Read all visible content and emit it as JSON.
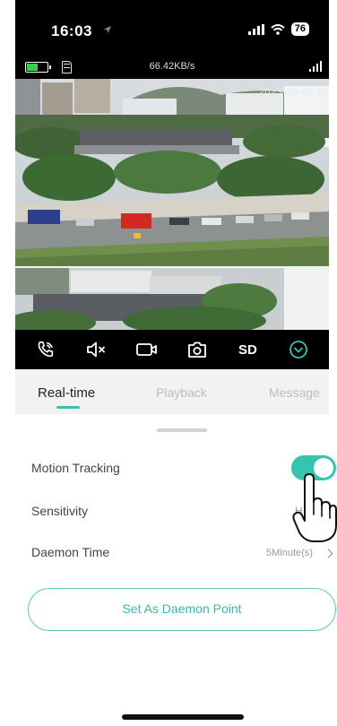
{
  "status_bar": {
    "time": "16:03",
    "battery": "76"
  },
  "camera_info": {
    "speed": "66.42KB/s",
    "battery_level": 0.5
  },
  "feed": {
    "timestamp": "2023-09-08 16:0"
  },
  "toolbar": {
    "items": [
      {
        "icon": "phone-call-icon"
      },
      {
        "icon": "speaker-mute-icon"
      },
      {
        "icon": "record-icon"
      },
      {
        "icon": "camera-icon"
      },
      {
        "label": "SD"
      },
      {
        "icon": "chevron-circle-icon"
      }
    ]
  },
  "tabs": {
    "realtime": "Real-time",
    "playback": "Playback",
    "message": "Message"
  },
  "settings": {
    "motion_tracking_label": "Motion Tracking",
    "motion_tracking_on": true,
    "sensitivity_label": "Sensitivity",
    "sensitivity_value": "H",
    "daemon_time_label": "Daemon Time",
    "daemon_time_value": "5Minute(s)"
  },
  "daemon_button": "Set As Daemon Point",
  "colors": {
    "accent": "#36c2b0",
    "toolbar_bg": "#000000",
    "tabs_bg": "#f2f2f2"
  }
}
